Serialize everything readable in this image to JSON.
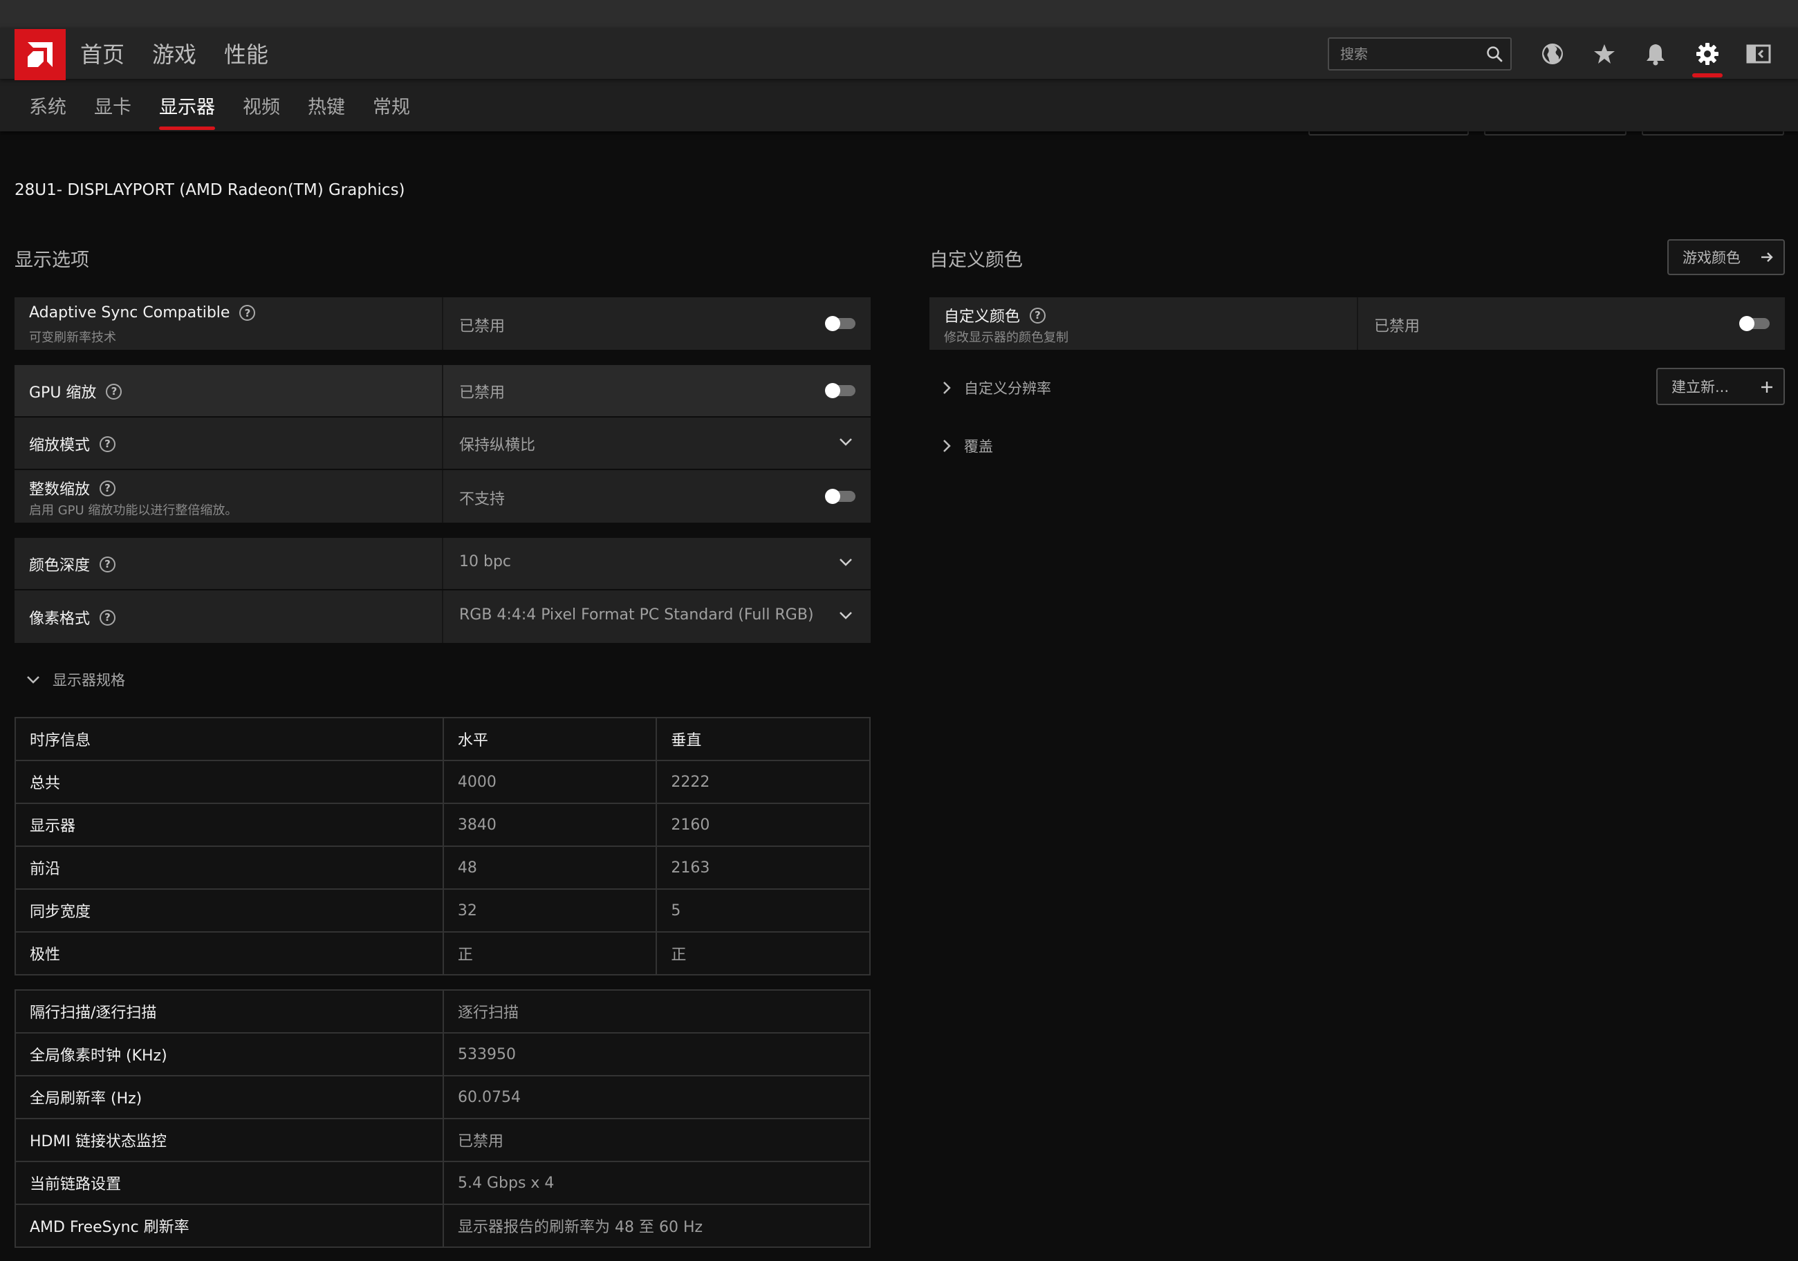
{
  "header": {
    "nav": [
      "首页",
      "游戏",
      "性能"
    ],
    "search_placeholder": "搜索"
  },
  "top_icons": [
    "globe-icon",
    "star-icon",
    "bell-icon",
    "gear-icon",
    "sidebar-icon"
  ],
  "subnav": {
    "items": [
      "系统",
      "显卡",
      "显示器",
      "视频",
      "热键",
      "常规"
    ],
    "active": "显示器"
  },
  "device_name": "28U1- DISPLAYPORT (AMD Radeon(TM) Graphics)",
  "display_options": {
    "title": "显示选项",
    "adaptive_sync": {
      "label": "Adaptive Sync Compatible",
      "sub": "可变刷新率技术",
      "value": "已禁用",
      "enabled": false
    },
    "gpu_scaling": {
      "label": "GPU 缩放",
      "value": "已禁用",
      "enabled": false
    },
    "scaling_mode": {
      "label": "缩放模式",
      "value": "保持纵横比"
    },
    "integer_scaling": {
      "label": "整数缩放",
      "sub": "启用 GPU 缩放功能以进行整倍缩放。",
      "value": "不支持",
      "enabled": false
    },
    "color_depth": {
      "label": "颜色深度",
      "value": "10 bpc"
    },
    "pixel_format": {
      "label": "像素格式",
      "value": "RGB 4:4:4 Pixel Format PC Standard (Full RGB)"
    }
  },
  "display_specs": {
    "toggle_label": "显示器规格",
    "timing_headers": [
      "时序信息",
      "水平",
      "垂直"
    ],
    "timing_rows": [
      [
        "总共",
        "4000",
        "2222"
      ],
      [
        "显示器",
        "3840",
        "2160"
      ],
      [
        "前沿",
        "48",
        "2163"
      ],
      [
        "同步宽度",
        "32",
        "5"
      ],
      [
        "极性",
        "正",
        "正"
      ]
    ],
    "info_rows": [
      [
        "隔行扫描/逐行扫描",
        "逐行扫描"
      ],
      [
        "全局像素时钟 (KHz)",
        "533950"
      ],
      [
        "全局刷新率 (Hz)",
        "60.0754"
      ],
      [
        "HDMI 链接状态监控",
        "已禁用"
      ],
      [
        "当前链路设置",
        "5.4 Gbps x 4"
      ],
      [
        "AMD FreeSync 刷新率",
        "显示器报告的刷新率为 48 至 60 Hz"
      ]
    ]
  },
  "custom_color": {
    "title": "自定义颜色",
    "game_color_button": "游戏颜色",
    "row": {
      "label": "自定义颜色",
      "sub": "修改显示器的颜色复制",
      "value": "已禁用",
      "enabled": false
    },
    "custom_resolution": "自定义分辨率",
    "create_new_button": "建立新...",
    "override": "覆盖"
  },
  "colors": {
    "accent": "#d7141b",
    "background": "#0d0d0d",
    "panel": "#222222"
  }
}
